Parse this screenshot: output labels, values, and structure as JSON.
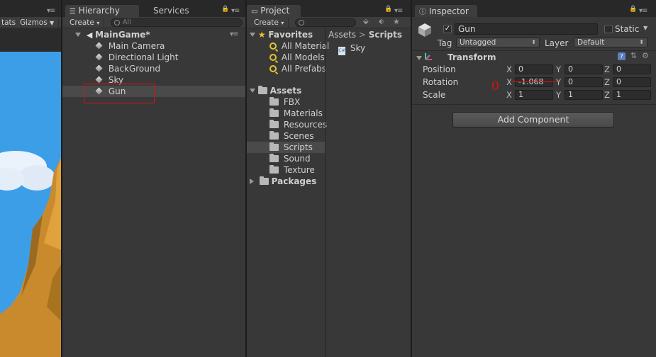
{
  "scene_view": {
    "toolbar_stats": "tats",
    "toolbar_gizmos": "Gizmos"
  },
  "hierarchy": {
    "tab_label": "Hierarchy",
    "services_tab_label": "Services",
    "create_label": "Create",
    "search_placeholder": "All",
    "scene_name": "MainGame*",
    "items": [
      {
        "label": "Main Camera"
      },
      {
        "label": "Directional Light"
      },
      {
        "label": "BackGround"
      },
      {
        "label": "Sky"
      },
      {
        "label": "Gun"
      }
    ]
  },
  "project": {
    "tab_label": "Project",
    "create_label": "Create",
    "favorites_label": "Favorites",
    "favorites": [
      {
        "label": "All Material"
      },
      {
        "label": "All Models"
      },
      {
        "label": "All Prefabs"
      }
    ],
    "assets_label": "Assets",
    "folders": [
      {
        "label": "FBX"
      },
      {
        "label": "Materials"
      },
      {
        "label": "Resources"
      },
      {
        "label": "Scenes"
      },
      {
        "label": "Scripts"
      },
      {
        "label": "Sound"
      },
      {
        "label": "Texture"
      }
    ],
    "packages_label": "Packages",
    "breadcrumb_root": "Assets",
    "breadcrumb_current": "Scripts",
    "files": [
      {
        "label": "Sky",
        "icon_text": "C#"
      }
    ]
  },
  "inspector": {
    "tab_label": "Inspector",
    "object_name": "Gun",
    "static_label": "Static",
    "tag_label": "Tag",
    "tag_value": "Untagged",
    "layer_label": "Layer",
    "layer_value": "Default",
    "transform_label": "Transform",
    "position_label": "Position",
    "rotation_label": "Rotation",
    "scale_label": "Scale",
    "axis_x": "X",
    "axis_y": "Y",
    "axis_z": "Z",
    "position": {
      "x": "0",
      "y": "0",
      "z": "0"
    },
    "rotation": {
      "x": "-1.068",
      "y": "0",
      "z": "0"
    },
    "scale": {
      "x": "1",
      "y": "1",
      "z": "1"
    },
    "annotation_text": "0",
    "add_component_label": "Add Component"
  },
  "colors": {
    "highlight_red": "#e01010",
    "favorites_star": "#e9c230",
    "sky_blue": "#3d9ee8",
    "rock_orange": "#c98a2e"
  }
}
